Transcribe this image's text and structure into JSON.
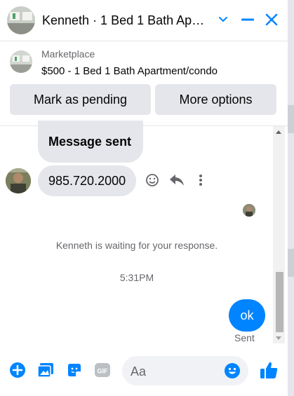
{
  "header": {
    "title": "Kenneth · 1 Bed 1 Bath Apartment/condo",
    "icons": [
      "chevron-down-icon",
      "minimize-icon",
      "close-icon"
    ]
  },
  "marketplace": {
    "label": "Marketplace",
    "listing": "$500 - 1 Bed 1 Bath Apartment/condo",
    "button_pending": "Mark as pending",
    "button_more": "More options"
  },
  "messages": {
    "sent_notice": "Message sent",
    "phone": "985.720.2000",
    "actions": [
      "smile-icon",
      "reply-icon",
      "more-vertical-icon"
    ],
    "waiting": "Kenneth is waiting for your response.",
    "timestamp": "5:31PM",
    "outgoing": "ok",
    "status": "Sent"
  },
  "composer": {
    "placeholder": "Aa",
    "icons": [
      "plus-icon",
      "photo-icon",
      "sticker-icon",
      "gif-icon",
      "emoji-icon",
      "thumbs-up-icon"
    ]
  },
  "colors": {
    "accent": "#0084ff",
    "bubble": "#e4e6eb",
    "muted": "#65676b"
  }
}
